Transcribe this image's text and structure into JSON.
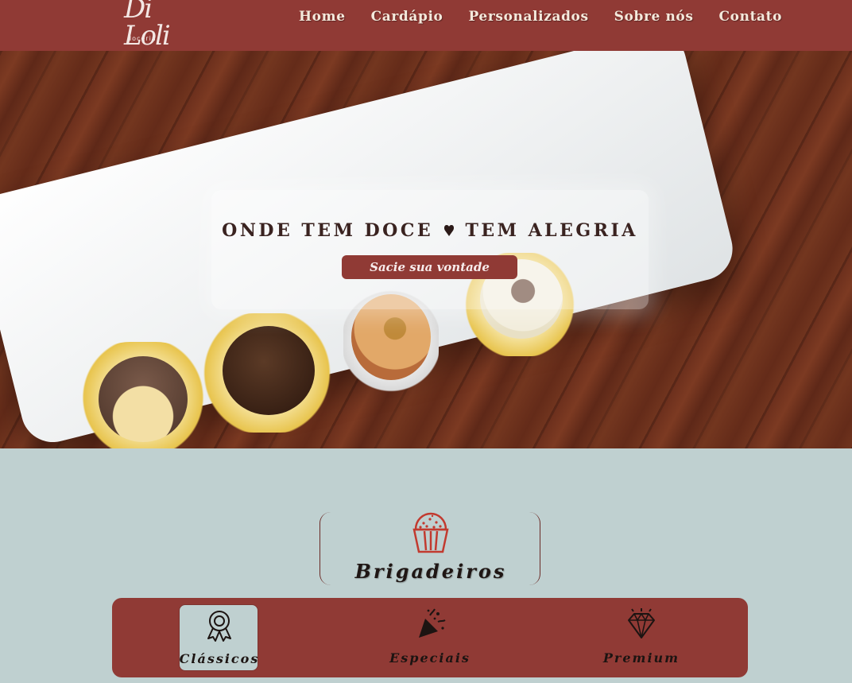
{
  "header": {
    "logo": {
      "mark": "Di Loli",
      "sub": "doceria"
    },
    "nav": [
      "Home",
      "Cardápio",
      "Personalizados",
      "Sobre nós",
      "Contato"
    ]
  },
  "hero": {
    "title_left": "ONDE TEM DOCE",
    "title_right": "TEM ALEGRIA",
    "title_icon": "heart-icon",
    "button_label": "Sacie sua vontade"
  },
  "category": {
    "icon": "cupcake-icon",
    "title": "Brigadeiros"
  },
  "tabs": [
    {
      "label": "Clássicos",
      "icon": "award-ribbon-icon",
      "active": true
    },
    {
      "label": "Especiais",
      "icon": "party-popper-icon",
      "active": false
    },
    {
      "label": "Premium",
      "icon": "diamond-icon",
      "active": false
    }
  ],
  "colors": {
    "brand": "#903a35",
    "background": "#bfd0d0",
    "nav_text": "#f4e9dc"
  }
}
